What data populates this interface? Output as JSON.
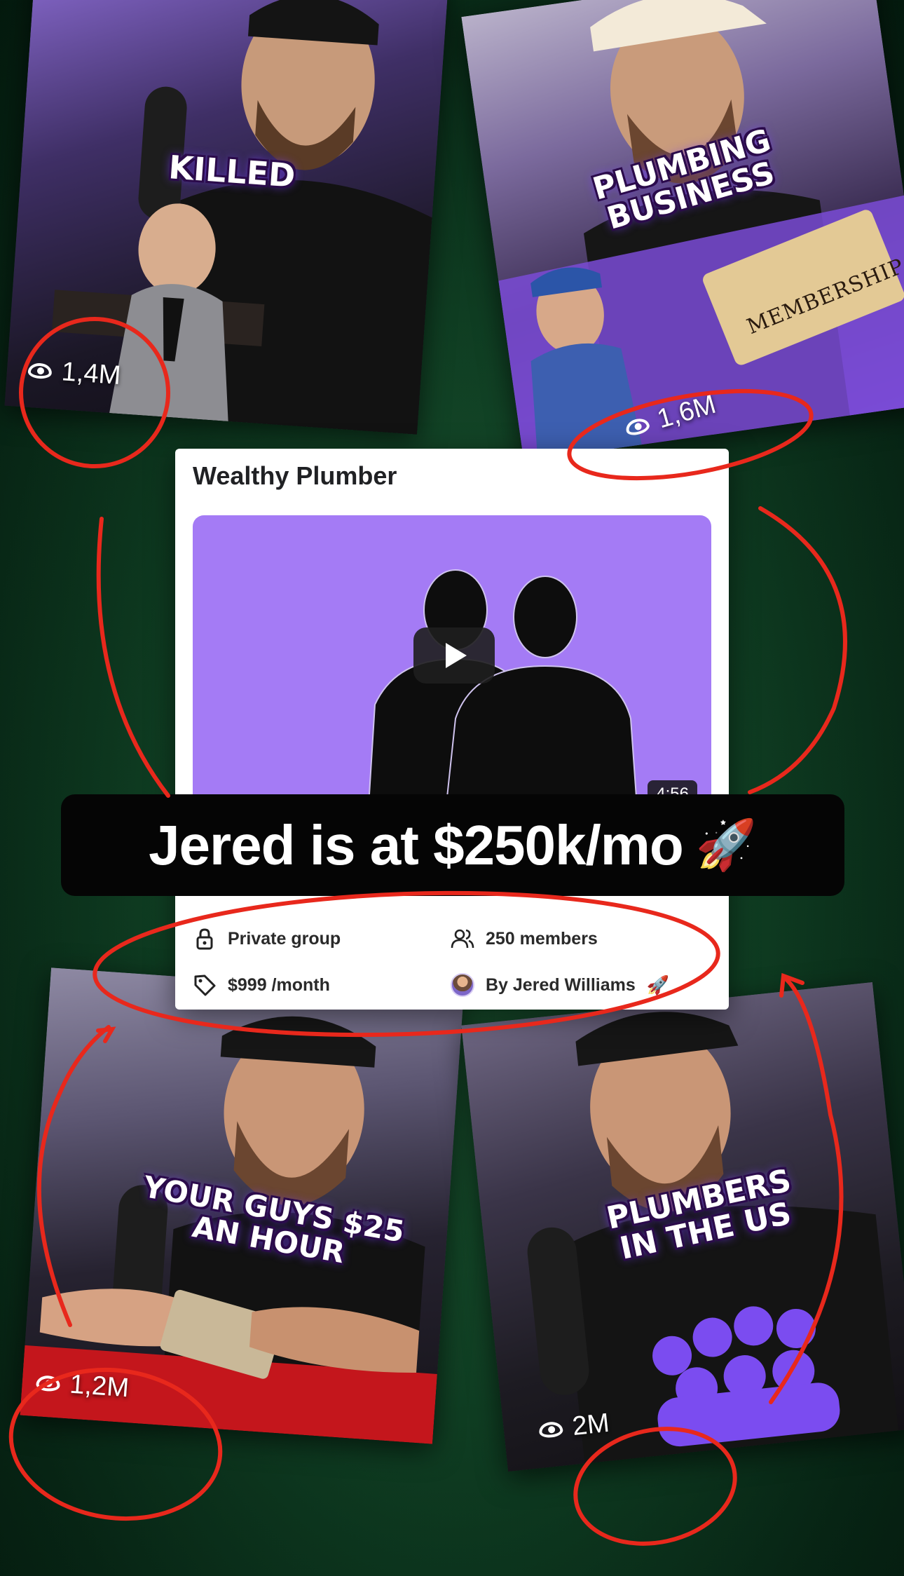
{
  "thumbnails": {
    "top_left": {
      "caption": "KILLED",
      "views": "1,4M"
    },
    "top_right": {
      "caption_line1": "PLUMBING",
      "caption_line2": "BUSINESS",
      "tag": "MEMBERSHIP",
      "views": "1,6M"
    },
    "bottom_left": {
      "caption_line1": "YOUR GUYS $25",
      "caption_line2": "AN HOUR",
      "views": "1,2M"
    },
    "bottom_right": {
      "caption_line1": "PLUMBERS",
      "caption_line2": "IN THE US",
      "views": "2M"
    }
  },
  "group_card": {
    "title": "Wealthy Plumber",
    "video_duration": "4:56",
    "privacy": "Private group",
    "members": "250 members",
    "price": "$999 /month",
    "owner": "By Jered Williams",
    "owner_emoji": "🚀"
  },
  "headline": {
    "text": "Jered is at $250k/mo",
    "emoji": "🚀"
  },
  "colors": {
    "background": "#0f3d22",
    "accent_purple": "#a47bf5",
    "annotation_red": "#e8281c"
  },
  "icons": [
    "eye-icon",
    "lock-icon",
    "members-icon",
    "tag-icon",
    "rocket-icon",
    "play-icon"
  ]
}
